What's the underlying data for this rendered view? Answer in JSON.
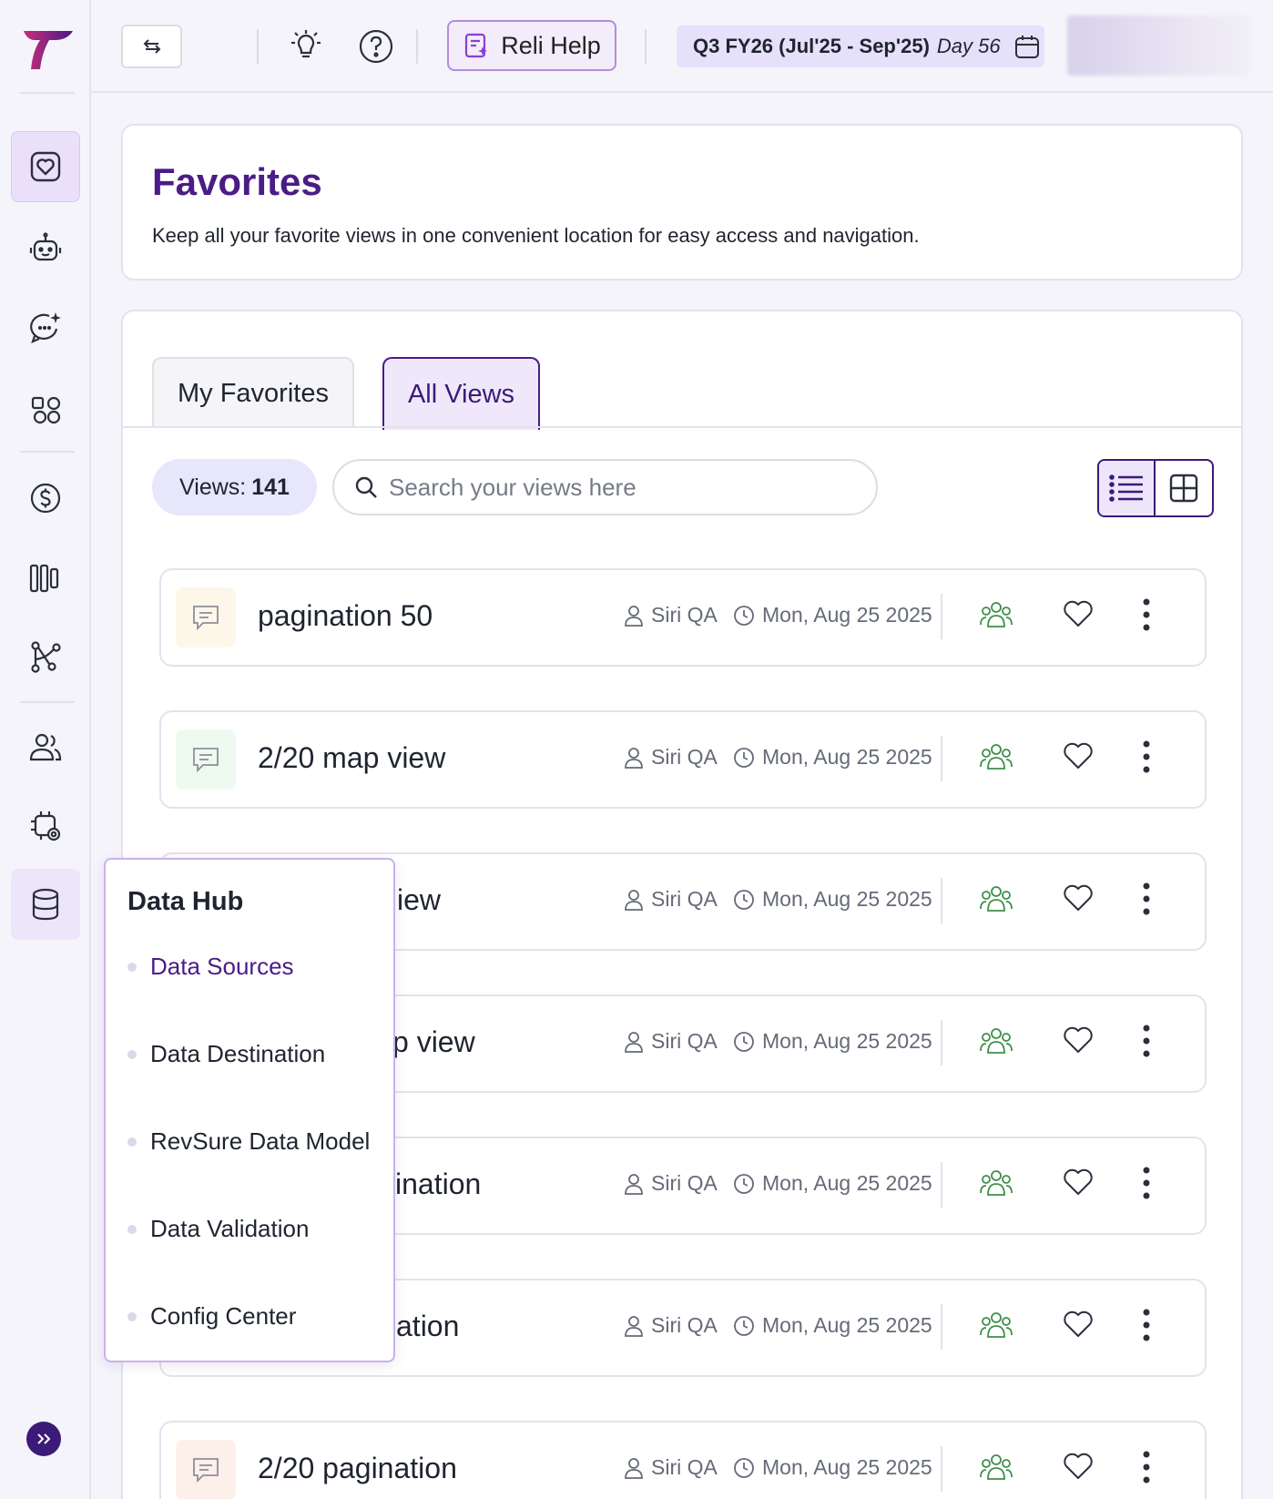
{
  "header": {
    "reli_help_label": "Reli Help",
    "period_label": "Q3 FY26 (Jul'25 - Sep'25)",
    "period_day": "Day 56"
  },
  "favorites": {
    "title": "Favorites",
    "subtitle": "Keep all your favorite views in one convenient location for easy access and navigation."
  },
  "tabs": [
    {
      "label": "My Favorites"
    },
    {
      "label": "All Views"
    }
  ],
  "toolbar": {
    "views_label": "Views:",
    "views_count": "141",
    "search_placeholder": "Search your views here"
  },
  "rows": [
    {
      "name": "pagination 50",
      "owner": "Siri QA",
      "date": "Mon, Aug 25 2025",
      "icon_color": "#fdf7ea"
    },
    {
      "name": "2/20 map view",
      "owner": "Siri QA",
      "date": "Mon, Aug 25 2025",
      "icon_color": "#eefaf0"
    },
    {
      "name": "iew",
      "owner": "Siri QA",
      "date": "Mon, Aug 25 2025",
      "icon_color": "#f3eefb"
    },
    {
      "name": "p view",
      "owner": "Siri QA",
      "date": "Mon, Aug 25 2025",
      "icon_color": "#eef3fb"
    },
    {
      "name": "ination",
      "owner": "Siri QA",
      "date": "Mon, Aug 25 2025",
      "icon_color": "#fdf3ea"
    },
    {
      "name": "ation",
      "owner": "Siri QA",
      "date": "Mon, Aug 25 2025",
      "icon_color": "#eefaf0"
    },
    {
      "name": "2/20 pagination",
      "owner": "Siri QA",
      "date": "Mon, Aug 25 2025",
      "icon_color": "#fdf0ea"
    }
  ],
  "flyout": {
    "title": "Data Hub",
    "items": [
      {
        "label": "Data Sources",
        "active": true
      },
      {
        "label": "Data Destination"
      },
      {
        "label": "RevSure Data Model"
      },
      {
        "label": "Data Validation"
      },
      {
        "label": "Config Center"
      }
    ]
  },
  "colors": {
    "brand": "#4b1c86",
    "share_icon": "#3f8f4a"
  },
  "sidebar": {
    "icons": [
      "favorites-icon",
      "bot-icon",
      "ai-chat-icon",
      "shapes-icon",
      "dollar-icon",
      "columns-icon",
      "flow-icon",
      "users-icon",
      "settings-chip-icon",
      "database-icon"
    ]
  }
}
